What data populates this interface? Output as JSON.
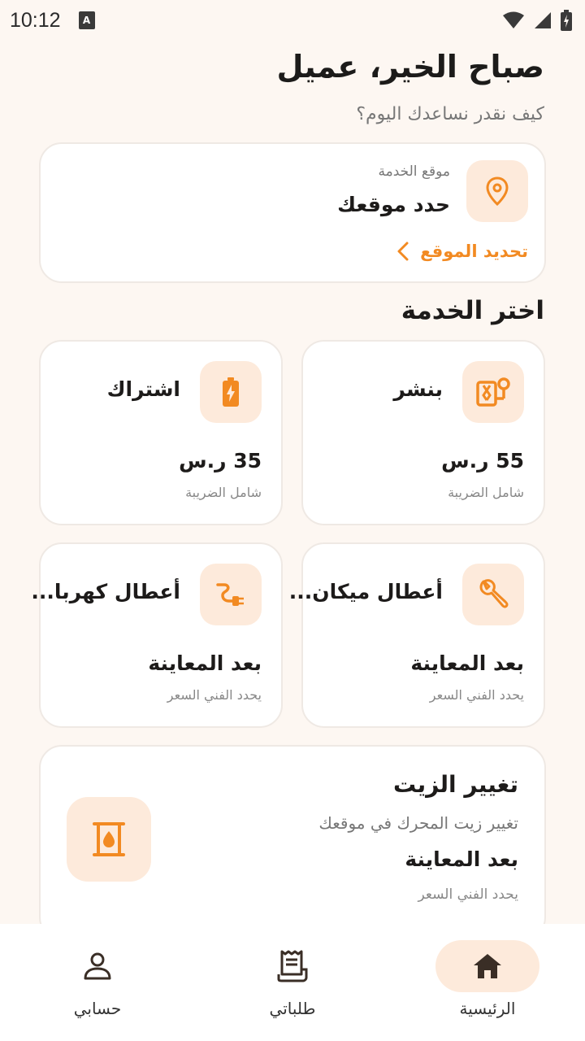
{
  "status_bar": {
    "time": "10:12",
    "sim_label": "A"
  },
  "header": {
    "greeting": "صباح الخير، عميل",
    "subtitle": "كيف نقدر نساعدك اليوم؟"
  },
  "location": {
    "label": "موقع الخدمة",
    "value": "حدد موقعك",
    "action_label": "تحديد الموقع",
    "icon": "location-pin-icon"
  },
  "services_section": {
    "title": "اختر الخدمة"
  },
  "services": [
    {
      "title": "بنشر",
      "price": "55 ر.س",
      "note": "شامل الضريبة",
      "icon": "tire-service-icon"
    },
    {
      "title": "اشتراك",
      "price": "35 ر.س",
      "note": "شامل الضريبة",
      "icon": "battery-charge-icon"
    },
    {
      "title": "أعطال ميكان...",
      "price": "بعد المعاينة",
      "note": "يحدد الفني السعر",
      "icon": "wrench-icon"
    },
    {
      "title": "أعطال كهربا...",
      "price": "بعد المعاينة",
      "note": "يحدد الفني السعر",
      "icon": "electric-plug-icon"
    }
  ],
  "oil_change": {
    "title": "تغيير الزيت",
    "description": "تغيير زيت المحرك في موقعك",
    "price": "بعد المعاينة",
    "note": "يحدد الفني السعر",
    "icon": "oil-barrel-icon"
  },
  "bottom_nav": {
    "items": [
      {
        "label": "الرئيسية",
        "icon": "home-icon",
        "active": true
      },
      {
        "label": "طلباتي",
        "icon": "receipt-icon",
        "active": false
      },
      {
        "label": "حسابي",
        "icon": "person-icon",
        "active": false
      }
    ]
  },
  "colors": {
    "accent": "#f28a22",
    "accent_soft": "#fdeadb",
    "background": "#fdf7f2"
  }
}
